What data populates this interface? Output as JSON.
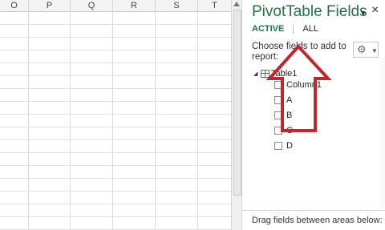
{
  "sheet": {
    "columns": [
      "O",
      "P",
      "Q",
      "R",
      "S",
      "T"
    ]
  },
  "pane": {
    "title": "PivotTable Fields",
    "menu_glyph": "▾",
    "close_glyph": "×",
    "tabs": {
      "active": "ACTIVE",
      "all": "ALL"
    },
    "instruction": "Choose fields to add to report:",
    "table_name": "Table1",
    "fields": [
      "Column1",
      "A",
      "B",
      "C",
      "D"
    ],
    "drag_text": "Drag fields between areas below:"
  },
  "annotation": {
    "color": "#c0282f"
  },
  "colors": {
    "accent": "#217346"
  }
}
